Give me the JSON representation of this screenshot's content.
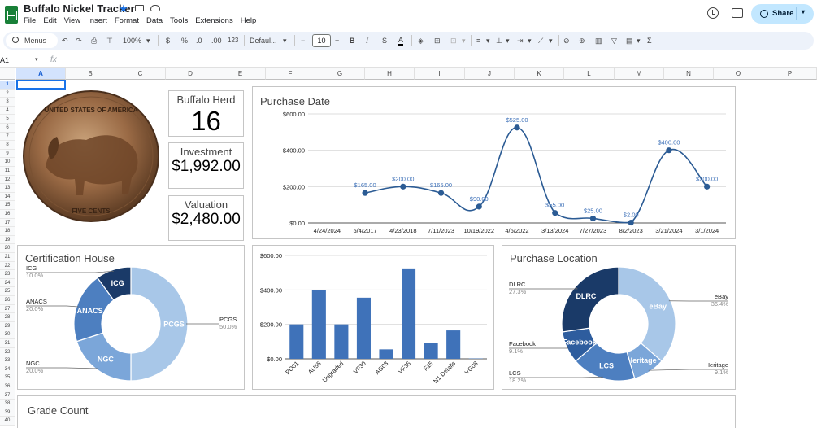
{
  "titlebar": {
    "title": "Buffalo Nickel Tracker",
    "star_glyph": "★",
    "icons": [
      "star-icon",
      "folder-icon",
      "cloud-icon",
      "history-icon",
      "comment-icon"
    ],
    "share_label": "Share"
  },
  "menu": [
    "File",
    "Edit",
    "View",
    "Insert",
    "Format",
    "Data",
    "Tools",
    "Extensions",
    "Help"
  ],
  "toolbar": {
    "menus_label": "Menus",
    "zoom": "100%",
    "currency": "$",
    "percent": "%",
    "dec_decrease": ".0",
    "dec_increase": ".00",
    "number_format": "123",
    "font": "Defaul...",
    "font_size": "10",
    "bold": "B",
    "italic": "I",
    "strike": "S",
    "text_color": "A",
    "sum": "Σ",
    "minus": "−",
    "plus": "+"
  },
  "formula_bar": {
    "cell": "A1",
    "fx": "fx"
  },
  "grid": {
    "columns": [
      "A",
      "B",
      "C",
      "D",
      "E",
      "F",
      "G",
      "H",
      "I",
      "J",
      "K",
      "L",
      "M",
      "N",
      "O",
      "P"
    ],
    "rows": [
      "1",
      "2",
      "3",
      "4",
      "5",
      "6",
      "7",
      "8",
      "9",
      "10",
      "11",
      "12",
      "13",
      "14",
      "15",
      "16",
      "17",
      "18",
      "19",
      "20",
      "21",
      "22",
      "23",
      "24",
      "25",
      "26",
      "27",
      "28",
      "29",
      "30",
      "31",
      "32",
      "33",
      "34",
      "35",
      "36",
      "37",
      "38",
      "39",
      "40"
    ],
    "active_col": "A",
    "active_row": "1"
  },
  "kpis": [
    {
      "label": "Buffalo Herd",
      "value": "16"
    },
    {
      "label": "Investment",
      "value": "$1,992.00"
    },
    {
      "label": "Valuation",
      "value": "$2,480.00"
    }
  ],
  "coin": {
    "top_text": "UNITED STATES OF AMERICA",
    "bottom_text": "FIVE CENTS"
  },
  "colors": {
    "dark": "#1a3a68",
    "mid": "#3f72b9",
    "accent": "#5b8fd0",
    "light": "#a8c7e8",
    "line": "#2b5b94",
    "green": "#188038",
    "share_bg": "#c2e7ff"
  },
  "chart_data": [
    {
      "type": "line",
      "title": "Purchase Date",
      "categories": [
        "4/24/2024",
        "5/4/2017",
        "4/23/2018",
        "7/11/2023",
        "10/19/2022",
        "4/6/2022",
        "3/13/2024",
        "7/27/2023",
        "8/2/2023",
        "3/21/2024",
        "3/1/2024"
      ],
      "values": [
        null,
        165,
        200,
        165,
        90,
        525,
        55,
        25,
        2,
        400,
        200
      ],
      "data_labels": [
        "",
        "$165.00",
        "$200.00",
        "$165.00",
        "$90.00",
        "$525.00",
        "$55.00",
        "$25.00",
        "$2.00",
        "$400.00",
        "$200.00"
      ],
      "yticks": [
        "$0.00",
        "$200.00",
        "$400.00",
        "$600.00"
      ],
      "ylim": [
        0,
        600
      ]
    },
    {
      "type": "pie",
      "title": "Certification House",
      "labels": [
        "PCGS",
        "NGC",
        "ANACS",
        "ICG"
      ],
      "values": [
        50,
        20,
        20,
        10
      ],
      "pct_labels": [
        "50.0%",
        "20.0%",
        "20.0%",
        "10.0%"
      ],
      "colors": [
        "#a8c7e8",
        "#7ba6d9",
        "#4d7fc0",
        "#1a3a68"
      ]
    },
    {
      "type": "bar",
      "categories": [
        "PO01",
        "AU55",
        "Ungraded",
        "VF30",
        "AG03",
        "VF35",
        "F15",
        "N1 Details",
        "VG08"
      ],
      "values": [
        200,
        400,
        200,
        355,
        55,
        525,
        90,
        165,
        2
      ],
      "yticks": [
        "$0.00",
        "$200.00",
        "$400.00",
        "$600.00"
      ],
      "ylim": [
        0,
        600
      ]
    },
    {
      "type": "pie",
      "title": "Purchase Location",
      "labels": [
        "eBay",
        "Heritage",
        "LCS",
        "Facebook",
        "DLRC"
      ],
      "values": [
        36.4,
        9.1,
        18.2,
        9.1,
        27.3
      ],
      "pct_labels": [
        "36.4%",
        "9.1%",
        "18.2%",
        "9.1%",
        "27.3%"
      ],
      "colors": [
        "#a8c7e8",
        "#7ba6d9",
        "#4d7fc0",
        "#2e5d9e",
        "#1a3a68"
      ]
    }
  ],
  "grade_count": {
    "title": "Grade Count"
  }
}
